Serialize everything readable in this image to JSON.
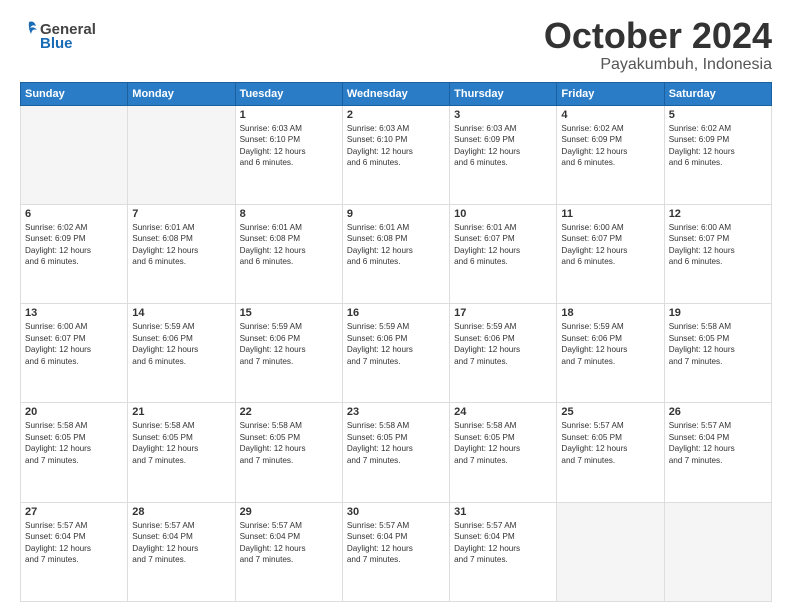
{
  "header": {
    "logo_general": "General",
    "logo_blue": "Blue",
    "month": "October 2024",
    "location": "Payakumbuh, Indonesia"
  },
  "days_of_week": [
    "Sunday",
    "Monday",
    "Tuesday",
    "Wednesday",
    "Thursday",
    "Friday",
    "Saturday"
  ],
  "weeks": [
    [
      {
        "day": "",
        "info": ""
      },
      {
        "day": "",
        "info": ""
      },
      {
        "day": "1",
        "info": "Sunrise: 6:03 AM\nSunset: 6:10 PM\nDaylight: 12 hours\nand 6 minutes."
      },
      {
        "day": "2",
        "info": "Sunrise: 6:03 AM\nSunset: 6:10 PM\nDaylight: 12 hours\nand 6 minutes."
      },
      {
        "day": "3",
        "info": "Sunrise: 6:03 AM\nSunset: 6:09 PM\nDaylight: 12 hours\nand 6 minutes."
      },
      {
        "day": "4",
        "info": "Sunrise: 6:02 AM\nSunset: 6:09 PM\nDaylight: 12 hours\nand 6 minutes."
      },
      {
        "day": "5",
        "info": "Sunrise: 6:02 AM\nSunset: 6:09 PM\nDaylight: 12 hours\nand 6 minutes."
      }
    ],
    [
      {
        "day": "6",
        "info": "Sunrise: 6:02 AM\nSunset: 6:09 PM\nDaylight: 12 hours\nand 6 minutes."
      },
      {
        "day": "7",
        "info": "Sunrise: 6:01 AM\nSunset: 6:08 PM\nDaylight: 12 hours\nand 6 minutes."
      },
      {
        "day": "8",
        "info": "Sunrise: 6:01 AM\nSunset: 6:08 PM\nDaylight: 12 hours\nand 6 minutes."
      },
      {
        "day": "9",
        "info": "Sunrise: 6:01 AM\nSunset: 6:08 PM\nDaylight: 12 hours\nand 6 minutes."
      },
      {
        "day": "10",
        "info": "Sunrise: 6:01 AM\nSunset: 6:07 PM\nDaylight: 12 hours\nand 6 minutes."
      },
      {
        "day": "11",
        "info": "Sunrise: 6:00 AM\nSunset: 6:07 PM\nDaylight: 12 hours\nand 6 minutes."
      },
      {
        "day": "12",
        "info": "Sunrise: 6:00 AM\nSunset: 6:07 PM\nDaylight: 12 hours\nand 6 minutes."
      }
    ],
    [
      {
        "day": "13",
        "info": "Sunrise: 6:00 AM\nSunset: 6:07 PM\nDaylight: 12 hours\nand 6 minutes."
      },
      {
        "day": "14",
        "info": "Sunrise: 5:59 AM\nSunset: 6:06 PM\nDaylight: 12 hours\nand 6 minutes."
      },
      {
        "day": "15",
        "info": "Sunrise: 5:59 AM\nSunset: 6:06 PM\nDaylight: 12 hours\nand 7 minutes."
      },
      {
        "day": "16",
        "info": "Sunrise: 5:59 AM\nSunset: 6:06 PM\nDaylight: 12 hours\nand 7 minutes."
      },
      {
        "day": "17",
        "info": "Sunrise: 5:59 AM\nSunset: 6:06 PM\nDaylight: 12 hours\nand 7 minutes."
      },
      {
        "day": "18",
        "info": "Sunrise: 5:59 AM\nSunset: 6:06 PM\nDaylight: 12 hours\nand 7 minutes."
      },
      {
        "day": "19",
        "info": "Sunrise: 5:58 AM\nSunset: 6:05 PM\nDaylight: 12 hours\nand 7 minutes."
      }
    ],
    [
      {
        "day": "20",
        "info": "Sunrise: 5:58 AM\nSunset: 6:05 PM\nDaylight: 12 hours\nand 7 minutes."
      },
      {
        "day": "21",
        "info": "Sunrise: 5:58 AM\nSunset: 6:05 PM\nDaylight: 12 hours\nand 7 minutes."
      },
      {
        "day": "22",
        "info": "Sunrise: 5:58 AM\nSunset: 6:05 PM\nDaylight: 12 hours\nand 7 minutes."
      },
      {
        "day": "23",
        "info": "Sunrise: 5:58 AM\nSunset: 6:05 PM\nDaylight: 12 hours\nand 7 minutes."
      },
      {
        "day": "24",
        "info": "Sunrise: 5:58 AM\nSunset: 6:05 PM\nDaylight: 12 hours\nand 7 minutes."
      },
      {
        "day": "25",
        "info": "Sunrise: 5:57 AM\nSunset: 6:05 PM\nDaylight: 12 hours\nand 7 minutes."
      },
      {
        "day": "26",
        "info": "Sunrise: 5:57 AM\nSunset: 6:04 PM\nDaylight: 12 hours\nand 7 minutes."
      }
    ],
    [
      {
        "day": "27",
        "info": "Sunrise: 5:57 AM\nSunset: 6:04 PM\nDaylight: 12 hours\nand 7 minutes."
      },
      {
        "day": "28",
        "info": "Sunrise: 5:57 AM\nSunset: 6:04 PM\nDaylight: 12 hours\nand 7 minutes."
      },
      {
        "day": "29",
        "info": "Sunrise: 5:57 AM\nSunset: 6:04 PM\nDaylight: 12 hours\nand 7 minutes."
      },
      {
        "day": "30",
        "info": "Sunrise: 5:57 AM\nSunset: 6:04 PM\nDaylight: 12 hours\nand 7 minutes."
      },
      {
        "day": "31",
        "info": "Sunrise: 5:57 AM\nSunset: 6:04 PM\nDaylight: 12 hours\nand 7 minutes."
      },
      {
        "day": "",
        "info": ""
      },
      {
        "day": "",
        "info": ""
      }
    ]
  ]
}
